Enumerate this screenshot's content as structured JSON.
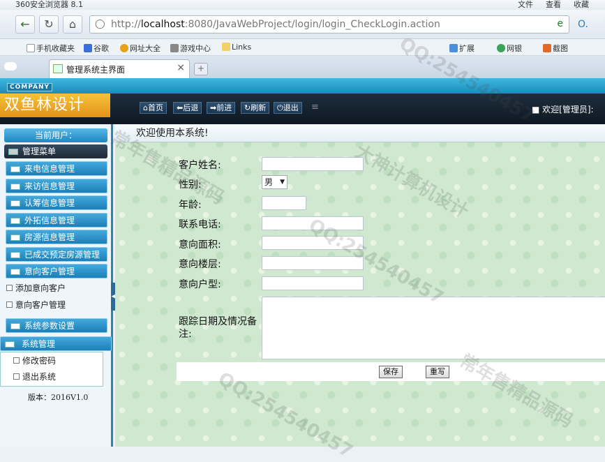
{
  "browser": {
    "title": "360安全浏览器 8.1",
    "menu": [
      "文件",
      "查看",
      "收藏"
    ],
    "url_prefix": "http://",
    "url_host": "localhost",
    "url_rest": ":8080/JavaWebProject/login/login_CheckLogin.action",
    "favorites": [
      "手机收藏夹",
      "谷歌",
      "网址大全",
      "游戏中心",
      "Links"
    ],
    "right_tools": [
      "扩展",
      "网银",
      "截图"
    ],
    "tab_label": "管理系统主界面"
  },
  "header": {
    "company": "COMPANY",
    "logo": "双鱼林设计",
    "buttons": [
      "首页",
      "后退",
      "前进",
      "刷新",
      "退出"
    ],
    "welcome": "欢迎[管理员]:"
  },
  "sidebar": {
    "current_user": "当前用户：",
    "menu_title": "管理菜单",
    "items": [
      "来电信息管理",
      "来访信息管理",
      "认筹信息管理",
      "外拓信息管理",
      "房源信息管理",
      "已成交预定房源管理",
      "意向客户管理"
    ],
    "subitems": [
      "添加意向客户",
      "意向客户管理"
    ],
    "params": "系统参数设置",
    "sys_title": "系统管理",
    "sys_items": [
      "修改密码",
      "退出系统"
    ],
    "version": "版本：2016V1.0"
  },
  "content": {
    "title": "欢迎使用本系统!",
    "labels": [
      "客户姓名:",
      "性别:",
      "年龄:",
      "联系电话:",
      "意向面积:",
      "意向楼层:",
      "意向户型:"
    ],
    "gender_value": "男",
    "notes_label": "跟踪日期及情况备注:",
    "save": "保存",
    "reset": "重写"
  },
  "watermarks": [
    "大神计算机设计",
    "QQ:254540457",
    "常年售精品源码"
  ]
}
